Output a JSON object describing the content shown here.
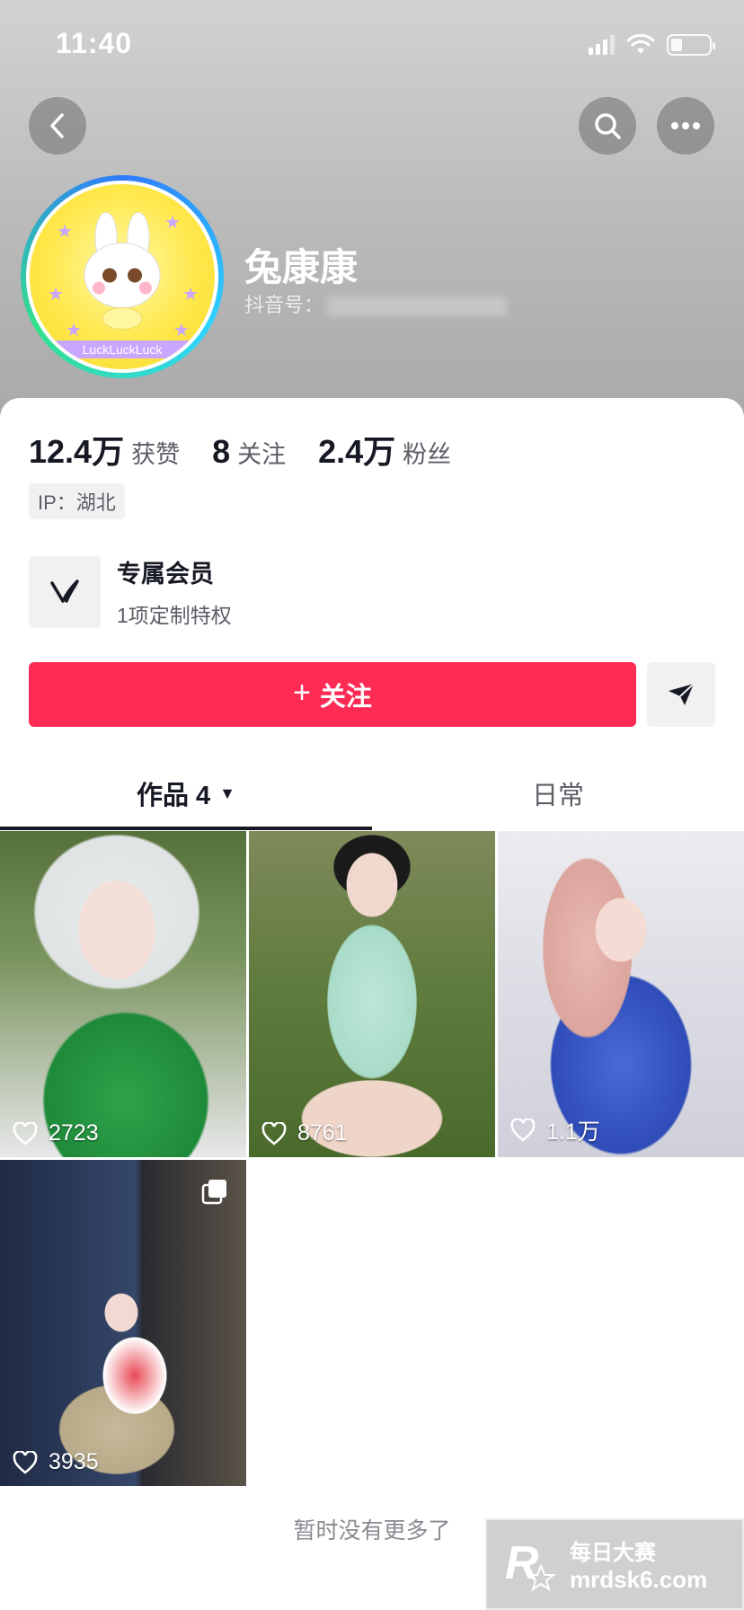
{
  "status_bar": {
    "time": "11:40"
  },
  "profile": {
    "nickname": "兔康康",
    "douyin_id_label": "抖音号：",
    "avatar_caption": "LuckLuckLuck"
  },
  "stats": [
    {
      "num": "12.4万",
      "label": "获赞"
    },
    {
      "num": "8",
      "label": "关注"
    },
    {
      "num": "2.4万",
      "label": "粉丝"
    }
  ],
  "ip_location": "IP：湖北",
  "member": {
    "title": "专属会员",
    "subtitle": "1项定制特权"
  },
  "follow_button": {
    "plus": "+",
    "label": "关注"
  },
  "tabs": [
    {
      "label": "作品 4",
      "caret": "▼"
    },
    {
      "label": "日常"
    }
  ],
  "videos": [
    {
      "likes": "2723"
    },
    {
      "likes": "8761"
    },
    {
      "likes": "1.1万"
    },
    {
      "likes": "3935"
    }
  ],
  "no_more_text": "暂时没有更多了",
  "watermark": {
    "line1": "每日大赛",
    "line2": "mrdsk6.com",
    "logo": "R"
  },
  "colors": {
    "accent": "#fe2c55",
    "text_primary": "#161823",
    "text_secondary": "#5c5d66"
  }
}
